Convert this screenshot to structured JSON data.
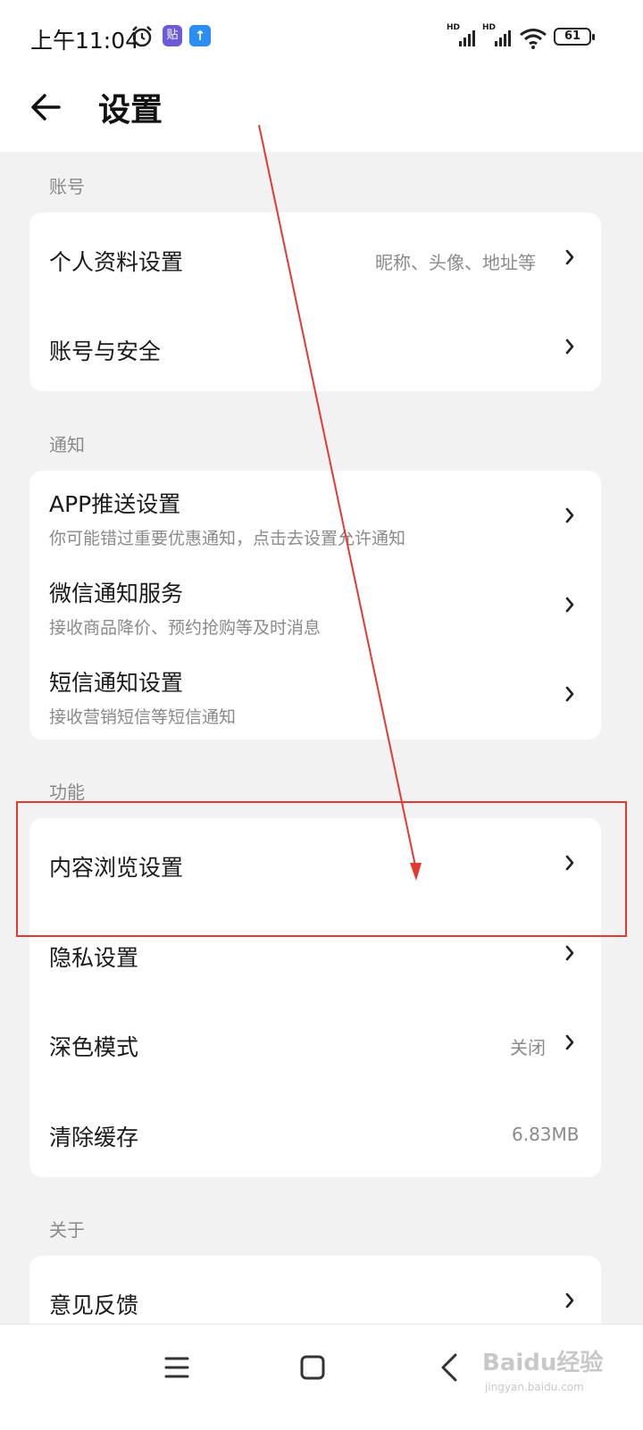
{
  "status_bar": {
    "time": "上午11:04",
    "tieba_label": "贴",
    "battery": "61",
    "hd_1": "HD",
    "hd_2": "HD"
  },
  "header": {
    "title": "设置"
  },
  "sections": {
    "account": {
      "label": "账号",
      "items": [
        {
          "title": "个人资料设置",
          "value": "昵称、头像、地址等"
        },
        {
          "title": "账号与安全"
        }
      ]
    },
    "notification": {
      "label": "通知",
      "items": [
        {
          "title": "APP推送设置",
          "subtitle": "你可能错过重要优惠通知，点击去设置允许通知"
        },
        {
          "title": "微信通知服务",
          "subtitle": "接收商品降价、预约抢购等及时消息"
        },
        {
          "title": "短信通知设置",
          "subtitle": "接收营销短信等短信通知"
        }
      ]
    },
    "features": {
      "label": "功能",
      "items": [
        {
          "title": "内容浏览设置"
        },
        {
          "title": "隐私设置"
        },
        {
          "title": "深色模式",
          "value": "关闭"
        },
        {
          "title": "清除缓存",
          "value": "6.83MB"
        }
      ]
    },
    "about": {
      "label": "关于",
      "items": [
        {
          "title": "意见反馈"
        }
      ]
    }
  },
  "watermark": {
    "text": "Baidu经验",
    "sub": "jingyan.baidu.com"
  },
  "colors": {
    "highlight": "#e23a33",
    "background": "#f2f2f2",
    "card": "#ffffff"
  }
}
